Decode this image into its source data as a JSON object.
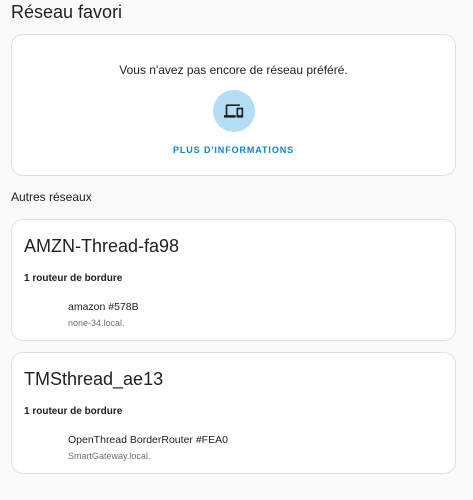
{
  "favorite": {
    "title": "Réseau favori",
    "empty_message": "Vous n'avez pas encore de réseau préféré.",
    "icon": "devices-icon",
    "more_info_label": "PLUS D'INFORMATIONS"
  },
  "others": {
    "title": "Autres réseaux",
    "networks": [
      {
        "name": "AMZN-Thread-fa98",
        "router_count": "1 routeur de bordure",
        "router": {
          "name": "amazon #578B",
          "host": "none-34.local."
        }
      },
      {
        "name": "TMSthread_ae13",
        "router_count": "1 routeur de bordure",
        "router": {
          "name": "OpenThread BorderRouter #FEA0",
          "host": "SmartGateway.local."
        }
      }
    ]
  },
  "colors": {
    "accent": "#0288d1",
    "icon_circle": "#b3dcf5",
    "icon_fg": "#212121"
  }
}
